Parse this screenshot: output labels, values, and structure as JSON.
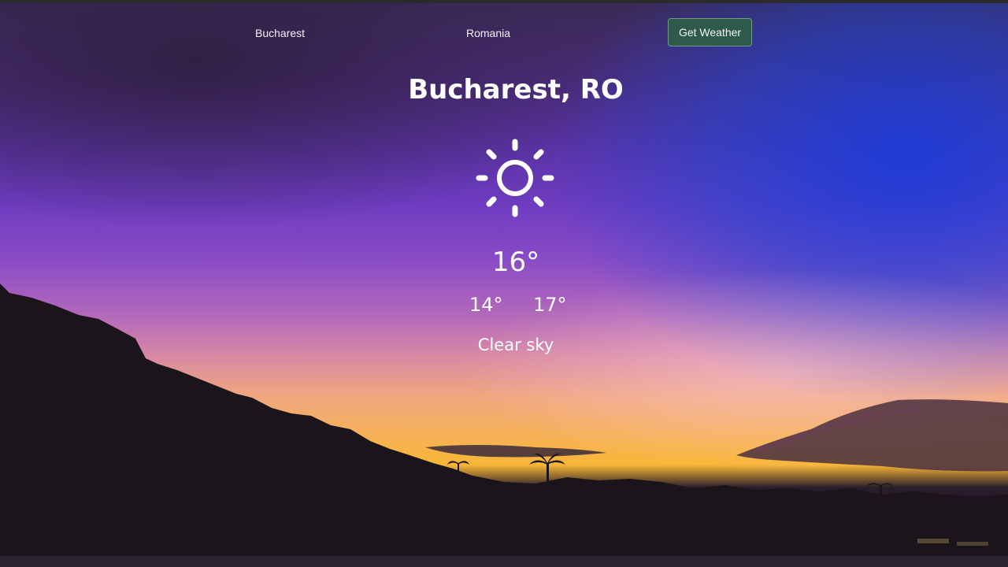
{
  "search": {
    "city_value": "Bucharest",
    "country_value": "Romania",
    "button_label": "Get Weather"
  },
  "weather": {
    "location": "Bucharest, RO",
    "icon": "sun-icon",
    "temperature": "16°",
    "temp_min": "14°",
    "temp_max": "17°",
    "description": "Clear sky"
  },
  "colors": {
    "button_bg": "#2e5a4c",
    "text": "#ffffff"
  }
}
